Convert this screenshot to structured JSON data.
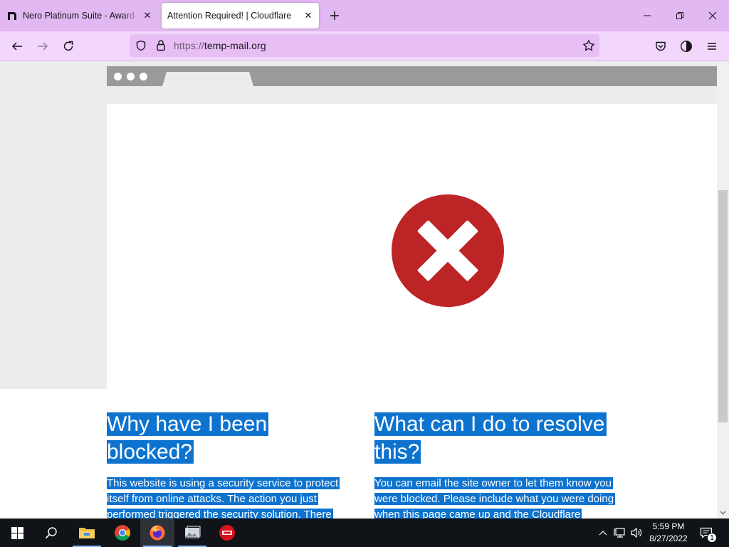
{
  "browser": {
    "tabs": [
      {
        "title": "Nero Platinum Suite - Award-winning",
        "active": false,
        "favicon": "nero-icon"
      },
      {
        "title": "Attention Required! | Cloudflare",
        "active": true
      }
    ],
    "url_scheme": "https://",
    "url_host": "temp-mail.org",
    "accent": "#e2b8f2",
    "toolbar_color": "#f2d6fb"
  },
  "page": {
    "left": {
      "heading": "Why have I been blocked?",
      "body": "This website is using a security service to protect itself from online attacks. The action you just performed triggered the security solution. There"
    },
    "right": {
      "heading": "What can I do to resolve this?",
      "body": "You can email the site owner to let them know you were blocked. Please include what you were doing when this page came up and the Cloudflare"
    },
    "error_color": "#bd2426",
    "selection_color": "#0e73cf"
  },
  "taskbar": {
    "pinned": [
      "start-button",
      "search-button",
      "file-explorer",
      "chrome",
      "firefox",
      "photo-viewer",
      "nero"
    ],
    "time": "5:59 PM",
    "date": "8/27/2022",
    "notification_count": "1"
  }
}
